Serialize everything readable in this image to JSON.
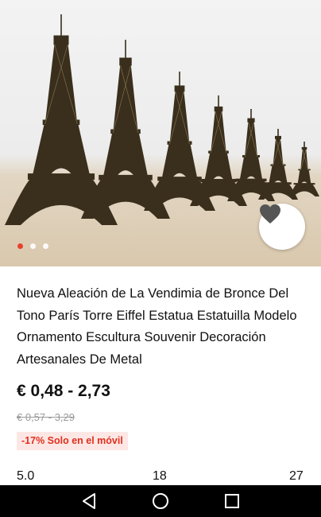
{
  "product": {
    "image_alt": "Eiffel tower figurines",
    "gallery_dots": 3,
    "gallery_active_index": 0,
    "title": "Nueva Aleación de La Vendimia de Bronce Del Tono París Torre Eiffel Estatua Estatuilla Modelo Ornamento Escultura Souvenir Decoración Artesanales De Metal",
    "price": "€ 0,48 - 2,73",
    "original_price": "€ 0,57 - 3,29",
    "promo_badge": "-17% Solo en el móvil",
    "rating": "5.0",
    "reviews_count": "18",
    "orders_count": "27"
  },
  "icons": {
    "favorite": "heart-icon",
    "nav_back": "back-triangle-icon",
    "nav_home": "home-circle-icon",
    "nav_recents": "recents-square-icon"
  },
  "colors": {
    "accent": "#e8412c",
    "promo_text": "#e0301e",
    "promo_bg": "#fde7e5",
    "bronze": "#3a2f1c"
  }
}
